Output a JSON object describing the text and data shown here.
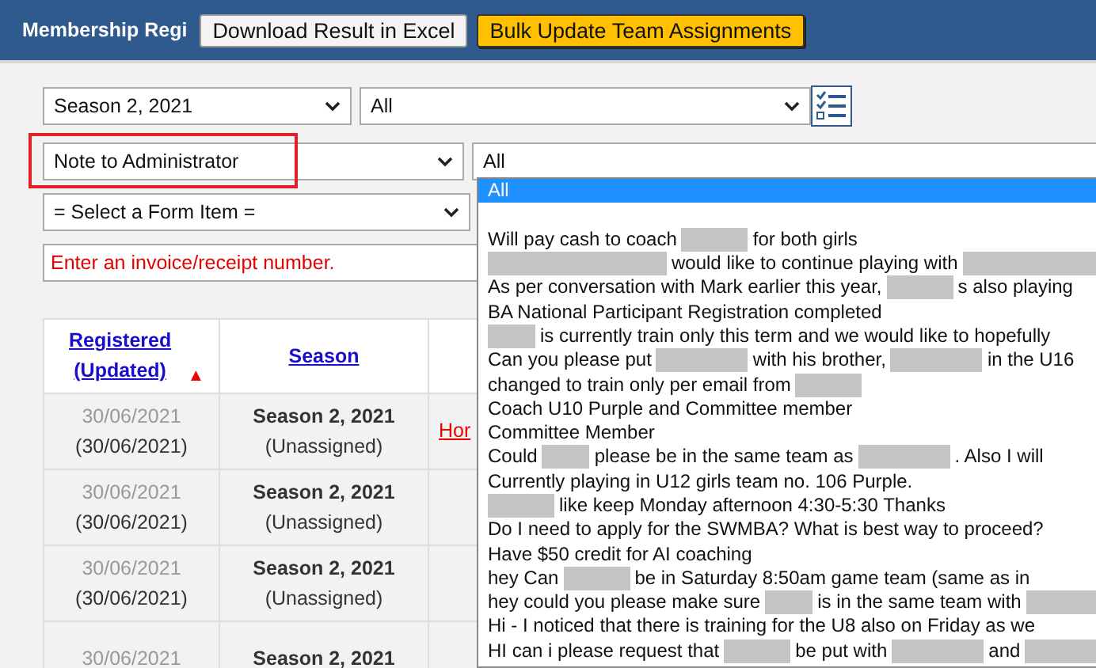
{
  "header": {
    "title": "Membership Regi",
    "buttons": [
      {
        "label": "Download Result in Excel",
        "kind": "plain"
      },
      {
        "label": "Bulk Update Team Assignments",
        "kind": "highlight"
      }
    ]
  },
  "filters": {
    "season": "Season 2, 2021",
    "group": "All",
    "form_item_type": {
      "value": "Note to Administrator",
      "highlighted": true
    },
    "form_item_value": "All",
    "form_item": "= Select a Form Item =",
    "invoice": {
      "placeholder": "Enter an invoice/receipt number."
    }
  },
  "dropdown": {
    "expanded": true,
    "options": [
      {
        "kind": "option",
        "selected": true,
        "parts": [
          {
            "kind": "text",
            "text": "All"
          }
        ]
      },
      {
        "kind": "empty"
      },
      {
        "kind": "option",
        "selected": false,
        "parts": [
          {
            "kind": "text",
            "text": "Will pay cash to coach"
          },
          {
            "kind": "redacted_medium"
          },
          {
            "kind": "text",
            "text": "for both girls"
          }
        ]
      },
      {
        "kind": "option",
        "selected": false,
        "parts": [
          {
            "kind": "redacted_xl"
          },
          {
            "kind": "text",
            "text": "would like to continue playing with"
          },
          {
            "kind": "redacted_xl"
          }
        ]
      },
      {
        "kind": "option",
        "selected": false,
        "parts": [
          {
            "kind": "text",
            "text": "As per conversation with Mark earlier this year,"
          },
          {
            "kind": "redacted_medium"
          },
          {
            "kind": "text",
            "text": "s also playing"
          }
        ]
      },
      {
        "kind": "option",
        "selected": false,
        "parts": [
          {
            "kind": "text",
            "text": "BA National Participant Registration completed"
          }
        ]
      },
      {
        "kind": "option",
        "selected": false,
        "parts": [
          {
            "kind": "redacted_short"
          },
          {
            "kind": "text",
            "text": "is currently train only this term and we would like to hopefully"
          }
        ]
      },
      {
        "kind": "option",
        "selected": false,
        "parts": [
          {
            "kind": "text",
            "text": "Can you please put"
          },
          {
            "kind": "redacted_long"
          },
          {
            "kind": "text",
            "text": "with his brother,"
          },
          {
            "kind": "redacted_long"
          },
          {
            "kind": "text",
            "text": "in the U16"
          }
        ]
      },
      {
        "kind": "option",
        "selected": false,
        "parts": [
          {
            "kind": "text",
            "text": "changed to train only per email from"
          },
          {
            "kind": "redacted_medium"
          }
        ]
      },
      {
        "kind": "option",
        "selected": false,
        "parts": [
          {
            "kind": "text",
            "text": "Coach U10 Purple and Committee member"
          }
        ]
      },
      {
        "kind": "option",
        "selected": false,
        "parts": [
          {
            "kind": "text",
            "text": "Committee Member"
          }
        ]
      },
      {
        "kind": "option",
        "selected": false,
        "parts": [
          {
            "kind": "text",
            "text": "Could"
          },
          {
            "kind": "redacted_short"
          },
          {
            "kind": "text",
            "text": "please be in the same team as"
          },
          {
            "kind": "redacted_long"
          },
          {
            "kind": "text",
            "text": ". Also I will"
          }
        ]
      },
      {
        "kind": "option",
        "selected": false,
        "parts": [
          {
            "kind": "text",
            "text": "Currently playing in U12 girls team no. 106 Purple."
          }
        ]
      },
      {
        "kind": "option",
        "selected": false,
        "parts": [
          {
            "kind": "redacted_medium"
          },
          {
            "kind": "text",
            "text": "like keep Monday afternoon 4:30-5:30 Thanks"
          }
        ]
      },
      {
        "kind": "option",
        "selected": false,
        "parts": [
          {
            "kind": "text",
            "text": "Do I need to apply for the SWMBA? What is best way to proceed?"
          }
        ]
      },
      {
        "kind": "option",
        "selected": false,
        "parts": [
          {
            "kind": "text",
            "text": "Have $50 credit for AI coaching"
          }
        ]
      },
      {
        "kind": "option",
        "selected": false,
        "parts": [
          {
            "kind": "text",
            "text": "hey Can"
          },
          {
            "kind": "redacted_medium"
          },
          {
            "kind": "text",
            "text": "be in Saturday 8:50am game team (same as in"
          }
        ]
      },
      {
        "kind": "option",
        "selected": false,
        "parts": [
          {
            "kind": "text",
            "text": "hey could you please make sure"
          },
          {
            "kind": "redacted_short"
          },
          {
            "kind": "text",
            "text": "is in the same team with"
          },
          {
            "kind": "redacted_xl"
          }
        ]
      },
      {
        "kind": "option",
        "selected": false,
        "parts": [
          {
            "kind": "text",
            "text": "Hi - I noticed that there is training for the U8 also on Friday as we"
          }
        ]
      },
      {
        "kind": "option",
        "selected": false,
        "parts": [
          {
            "kind": "text",
            "text": "HI can i please request that"
          },
          {
            "kind": "redacted_medium"
          },
          {
            "kind": "text",
            "text": "be put with"
          },
          {
            "kind": "redacted_long"
          },
          {
            "kind": "text",
            "text": "and"
          },
          {
            "kind": "redacted_xl"
          }
        ]
      }
    ]
  },
  "table": {
    "columns": [
      {
        "label": "Registered (Updated)",
        "sort_arrow": "▲"
      },
      {
        "label": "Season"
      },
      {}
    ],
    "rows": [
      {
        "registered": "30/06/2021",
        "updated": "(30/06/2021)",
        "season": "Season 2, 2021",
        "team": "(Unassigned)",
        "column_3": "Hor"
      },
      {
        "registered": "30/06/2021",
        "updated": "(30/06/2021)",
        "season": "Season 2, 2021",
        "team": "(Unassigned)"
      },
      {
        "registered": "30/06/2021",
        "updated": "(30/06/2021)",
        "season": "Season 2, 2021",
        "team": "(Unassigned)"
      },
      {
        "registered": "30/06/2021",
        "season": "Season 2, 2021"
      }
    ]
  }
}
